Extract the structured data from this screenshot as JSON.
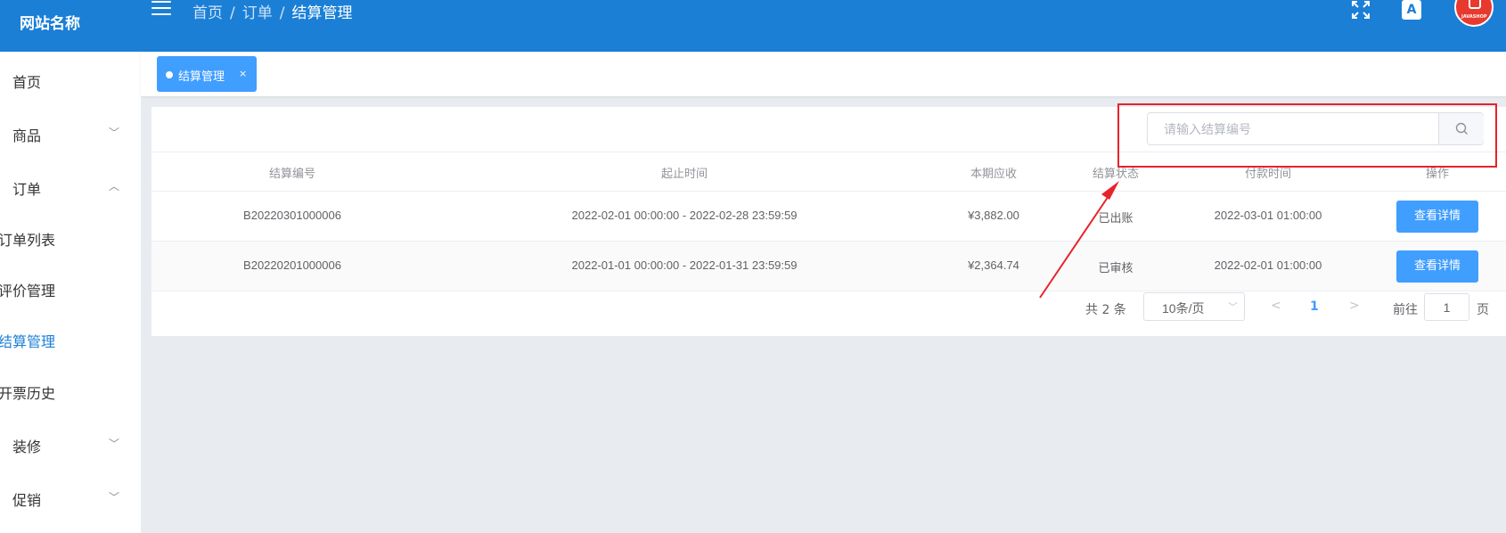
{
  "header": {
    "site_name": "网站名称",
    "breadcrumb": [
      "首页",
      "订单",
      "结算管理"
    ],
    "avatar_text": "JAVASHOP"
  },
  "sidebar": {
    "items": [
      {
        "label": "首页"
      },
      {
        "label": "商品"
      },
      {
        "label": "订单"
      },
      {
        "label": "订单列表"
      },
      {
        "label": "评价管理"
      },
      {
        "label": "结算管理"
      },
      {
        "label": "开票历史"
      },
      {
        "label": "装修"
      },
      {
        "label": "促销"
      }
    ]
  },
  "tabs": {
    "active": {
      "label": "结算管理",
      "close": "×"
    }
  },
  "search": {
    "placeholder": "请输入结算编号",
    "value": ""
  },
  "table": {
    "headers": [
      "结算编号",
      "起止时间",
      "本期应收",
      "结算状态",
      "付款时间",
      "操作"
    ],
    "rows": [
      {
        "id": "B20220301000006",
        "period": "2022-02-01 00:00:00 - 2022-02-28 23:59:59",
        "amount": "¥3,882.00",
        "status": "已出账",
        "pay_time": "2022-03-01 01:00:00",
        "action": "查看详情"
      },
      {
        "id": "B20220201000006",
        "period": "2022-01-01 00:00:00 - 2022-01-31 23:59:59",
        "amount": "¥2,364.74",
        "status": "已审核",
        "pay_time": "2022-02-01 01:00:00",
        "action": "查看详情"
      }
    ]
  },
  "pagination": {
    "total": "共 2 条",
    "page_size": "10条/页",
    "current_page": "1",
    "goto_label": "前往",
    "goto_value": "1",
    "page_suffix": "页"
  },
  "colors": {
    "header_bg": "#1b7fd6",
    "accent": "#409eff",
    "annotation": "#e8222a"
  }
}
